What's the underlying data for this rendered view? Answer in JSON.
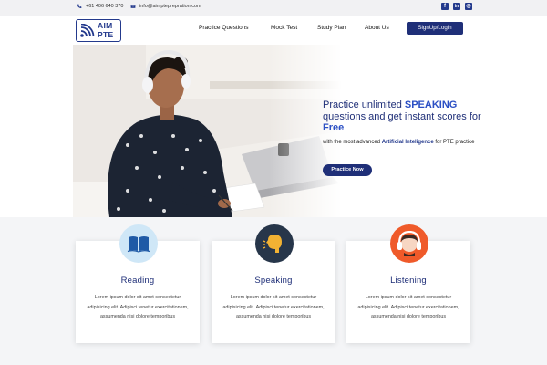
{
  "topbar": {
    "phone": "+61 406 640 370",
    "email": "info@aimpteprepration.com",
    "social": [
      {
        "icon": "facebook-icon",
        "glyph": "f"
      },
      {
        "icon": "linkedin-icon",
        "glyph": "in"
      },
      {
        "icon": "instagram-icon",
        "glyph": "◎"
      }
    ]
  },
  "brand": {
    "logo_line1": "AIM",
    "logo_line2": "PTE",
    "color": "#23398c"
  },
  "nav": {
    "links": [
      "Practice Questions",
      "Mock Test",
      "Study Plan",
      "About Us"
    ],
    "signup_label": "SignUp/Login"
  },
  "hero": {
    "title_part1": "Practice unlimited ",
    "title_highlight1": "SPEAKING",
    "title_part2": " questions and get instant scores for ",
    "title_highlight2": "Free",
    "subtitle_part1": "with the most advanced ",
    "subtitle_bold": "Artificial Inteligence",
    "subtitle_part2": " for PTE practice",
    "button_label": "Practice Now"
  },
  "cards": [
    {
      "title": "Reading",
      "icon": "book-icon",
      "circle_color": "#cfe7f7",
      "body": "Lorem ipsum dolor sit amet consectetur adipisicing elit. Adipisci tenetur exercitationem, assumenda nisi dolore temporibus"
    },
    {
      "title": "Speaking",
      "icon": "speaking-head-icon",
      "circle_color": "#27364a",
      "body": "Lorem ipsum dolor sit amet consectetur adipisicing elit. Adipisci tenetur exercitationem, assumenda nisi dolore temporibus"
    },
    {
      "title": "Listening",
      "icon": "headphones-icon",
      "circle_color": "#ef5a2a",
      "body": "Lorem ipsum dolor sit amet consectetur adipisicing elit. Adipisci tenetur exercitationem, assumenda nisi dolore temporibus"
    }
  ]
}
